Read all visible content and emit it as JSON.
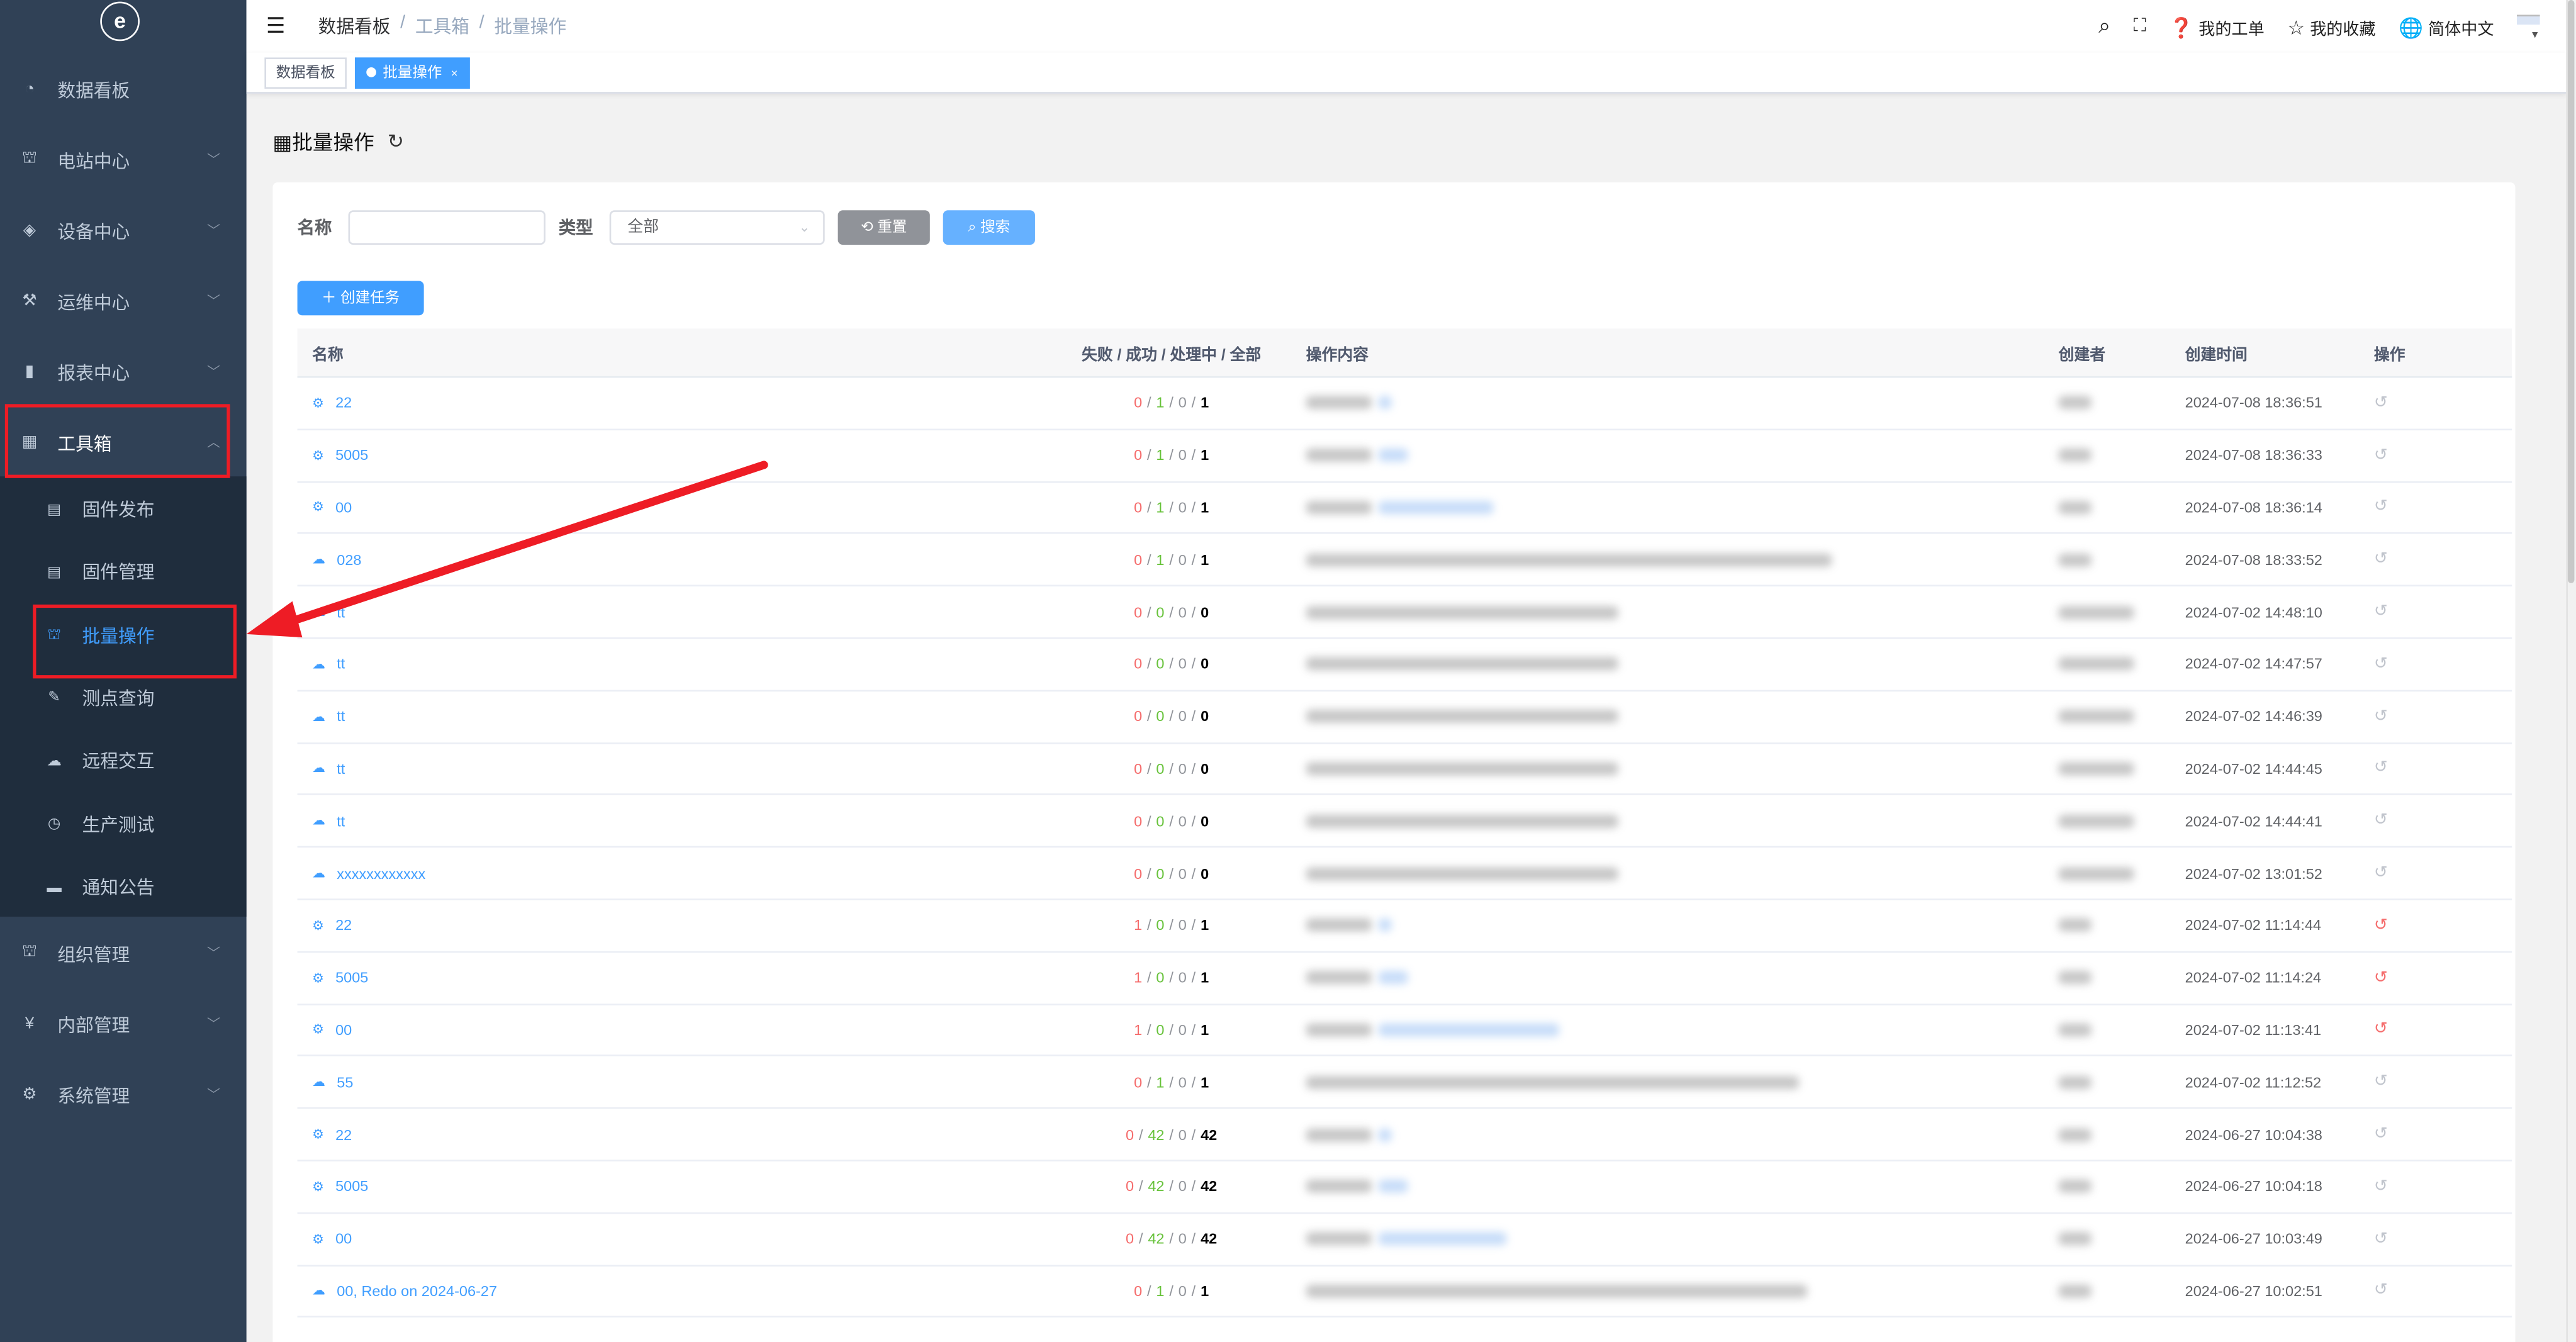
{
  "sidebar": {
    "logo": "e",
    "items": [
      {
        "label": "数据看板",
        "icon": "dashboard-icon",
        "expandable": false
      },
      {
        "label": "电站中心",
        "icon": "sitemap-icon",
        "expandable": true
      },
      {
        "label": "设备中心",
        "icon": "layers-icon",
        "expandable": true
      },
      {
        "label": "运维中心",
        "icon": "tool-icon",
        "expandable": true
      },
      {
        "label": "报表中心",
        "icon": "bar-chart-icon",
        "expandable": true
      },
      {
        "label": "工具箱",
        "icon": "table-icon",
        "expandable": true,
        "expanded": true
      },
      {
        "label": "组织管理",
        "icon": "sitemap-icon",
        "expandable": true
      },
      {
        "label": "内部管理",
        "icon": "yen-icon",
        "expandable": true
      },
      {
        "label": "系统管理",
        "icon": "gear-icon",
        "expandable": true
      }
    ],
    "toolbox_children": [
      {
        "label": "固件发布",
        "icon": "zip-icon"
      },
      {
        "label": "固件管理",
        "icon": "zip-icon"
      },
      {
        "label": "批量操作",
        "icon": "sitemap-icon",
        "active": true
      },
      {
        "label": "测点查询",
        "icon": "edit-icon"
      },
      {
        "label": "远程交互",
        "icon": "cloud-upload-icon"
      },
      {
        "label": "生产测试",
        "icon": "history-icon"
      },
      {
        "label": "通知公告",
        "icon": "message-icon"
      }
    ]
  },
  "header": {
    "breadcrumb": [
      "数据看板",
      "工具箱",
      "批量操作"
    ],
    "my_tickets": "我的工单",
    "my_favorites": "我的收藏",
    "language": "简体中文"
  },
  "tags": [
    {
      "label": "数据看板",
      "active": false
    },
    {
      "label": "批量操作",
      "active": true,
      "close": "×"
    }
  ],
  "page": {
    "title": "批量操作",
    "filters": {
      "name_label": "名称",
      "name_value": "",
      "type_label": "类型",
      "type_value": "全部",
      "reset_label": "重置",
      "search_label": "搜索"
    },
    "create_label": "创建任务"
  },
  "colors": {
    "primary": "#409eff",
    "fail": "#f56c6c",
    "success": "#67c23a",
    "sidebar": "#304156",
    "sidebar_sub": "#1f2d3d"
  },
  "table": {
    "headers": [
      "名称",
      "失败 / 成功 / 处理中 / 全部",
      "操作内容",
      "创建者",
      "创建时间",
      "操作"
    ],
    "rows": [
      {
        "icon": "gear-icon",
        "name": "22",
        "fail": "0",
        "success": "1",
        "processing": "0",
        "total": "1",
        "time": "2024-07-08 18:36:51",
        "retry_red": false
      },
      {
        "icon": "gear-icon",
        "name": "5005",
        "fail": "0",
        "success": "1",
        "processing": "0",
        "total": "1",
        "time": "2024-07-08 18:36:33",
        "retry_red": false
      },
      {
        "icon": "gear-icon",
        "name": "00",
        "fail": "0",
        "success": "1",
        "processing": "0",
        "total": "1",
        "time": "2024-07-08 18:36:14",
        "retry_red": false
      },
      {
        "icon": "cloud-upload-icon",
        "name": "028",
        "fail": "0",
        "success": "1",
        "processing": "0",
        "total": "1",
        "time": "2024-07-08 18:33:52",
        "retry_red": false
      },
      {
        "icon": "cloud-upload-icon",
        "name": "tt",
        "fail": "0",
        "success": "0",
        "processing": "0",
        "total": "0",
        "time": "2024-07-02 14:48:10",
        "retry_red": false
      },
      {
        "icon": "cloud-upload-icon",
        "name": "tt",
        "fail": "0",
        "success": "0",
        "processing": "0",
        "total": "0",
        "time": "2024-07-02 14:47:57",
        "retry_red": false
      },
      {
        "icon": "cloud-upload-icon",
        "name": "tt",
        "fail": "0",
        "success": "0",
        "processing": "0",
        "total": "0",
        "time": "2024-07-02 14:46:39",
        "retry_red": false
      },
      {
        "icon": "cloud-upload-icon",
        "name": "tt",
        "fail": "0",
        "success": "0",
        "processing": "0",
        "total": "0",
        "time": "2024-07-02 14:44:45",
        "retry_red": false
      },
      {
        "icon": "cloud-upload-icon",
        "name": "tt",
        "fail": "0",
        "success": "0",
        "processing": "0",
        "total": "0",
        "time": "2024-07-02 14:44:41",
        "retry_red": false
      },
      {
        "icon": "cloud-upload-icon",
        "name": "xxxxxxxxxxxx",
        "fail": "0",
        "success": "0",
        "processing": "0",
        "total": "0",
        "time": "2024-07-02 13:01:52",
        "retry_red": false
      },
      {
        "icon": "gear-icon",
        "name": "22",
        "fail": "1",
        "success": "0",
        "processing": "0",
        "total": "1",
        "time": "2024-07-02 11:14:44",
        "retry_red": true
      },
      {
        "icon": "gear-icon",
        "name": "5005",
        "fail": "1",
        "success": "0",
        "processing": "0",
        "total": "1",
        "time": "2024-07-02 11:14:24",
        "retry_red": true
      },
      {
        "icon": "gear-icon",
        "name": "00",
        "fail": "1",
        "success": "0",
        "processing": "0",
        "total": "1",
        "time": "2024-07-02 11:13:41",
        "retry_red": true
      },
      {
        "icon": "cloud-upload-icon",
        "name": "55",
        "fail": "0",
        "success": "1",
        "processing": "0",
        "total": "1",
        "time": "2024-07-02 11:12:52",
        "retry_red": false
      },
      {
        "icon": "gear-icon",
        "name": "22",
        "fail": "0",
        "success": "42",
        "processing": "0",
        "total": "42",
        "time": "2024-06-27 10:04:38",
        "retry_red": false
      },
      {
        "icon": "gear-icon",
        "name": "5005",
        "fail": "0",
        "success": "42",
        "processing": "0",
        "total": "42",
        "time": "2024-06-27 10:04:18",
        "retry_red": false
      },
      {
        "icon": "gear-icon",
        "name": "00",
        "fail": "0",
        "success": "42",
        "processing": "0",
        "total": "42",
        "time": "2024-06-27 10:03:49",
        "retry_red": false
      },
      {
        "icon": "cloud-upload-icon",
        "name": "00, Redo on 2024-06-27",
        "fail": "0",
        "success": "1",
        "processing": "0",
        "total": "1",
        "time": "2024-06-27 10:02:51",
        "retry_red": false
      }
    ]
  }
}
